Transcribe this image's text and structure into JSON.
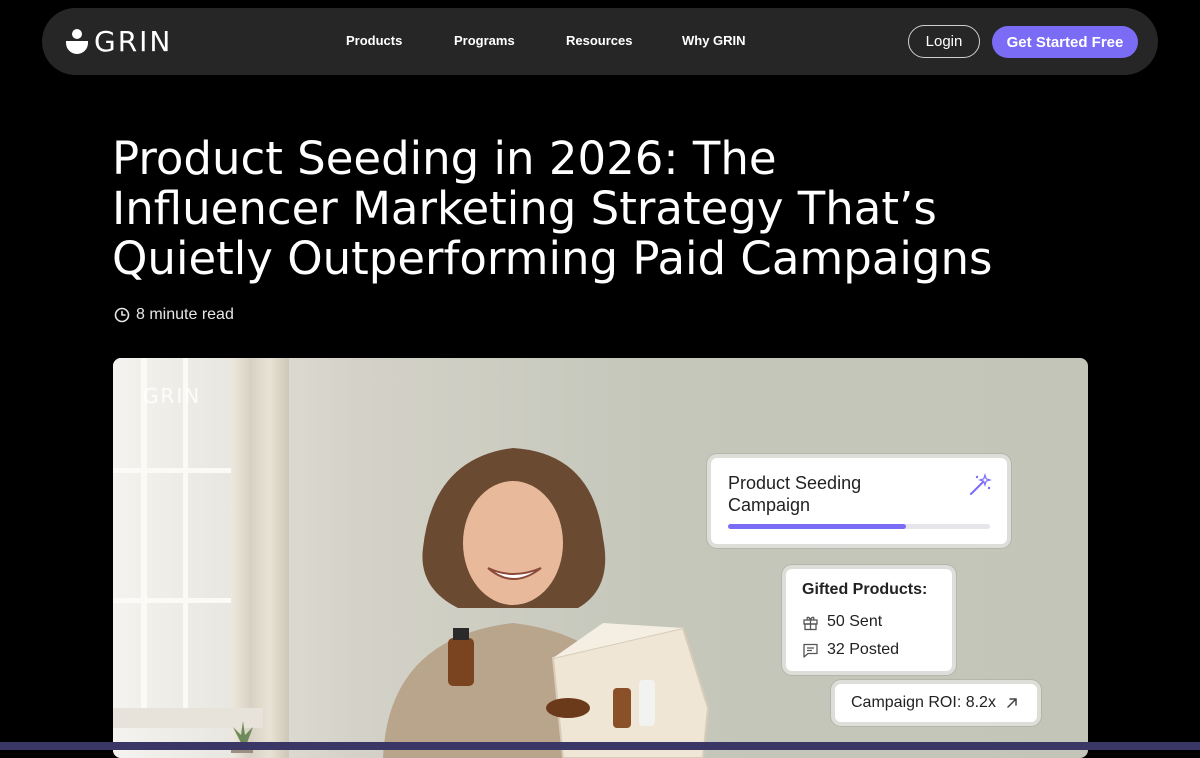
{
  "nav": {
    "logo_text": "GRIN",
    "links": [
      "Products",
      "Programs",
      "Resources",
      "Why GRIN"
    ],
    "login_label": "Login",
    "cta_label": "Get Started Free",
    "accent_color": "#7b6cf6"
  },
  "article": {
    "title": "Product Seeding in 2026: The Influencer Marketing Strategy That’s Quietly Outperforming Paid Campaigns",
    "read_time": "8 minute read"
  },
  "hero": {
    "watermark": "GRIN",
    "campaign_card": {
      "title": "Product Seeding Campaign",
      "progress_fraction": 0.68,
      "icon": "sparkle-wand-icon"
    },
    "gifted_card": {
      "title": "Gifted Products:",
      "sent": "50 Sent",
      "posted": "32 Posted"
    },
    "roi_card": {
      "label": "Campaign ROI: 8.2x"
    }
  }
}
